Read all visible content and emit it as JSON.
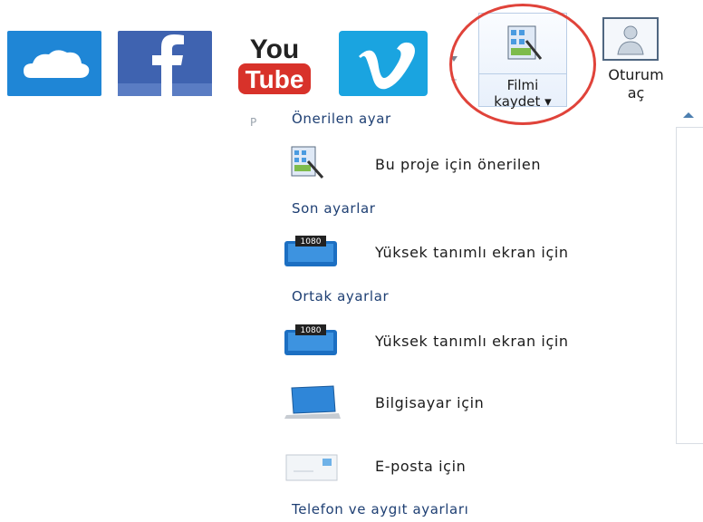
{
  "ribbon": {
    "youtube_top": "You",
    "youtube_bottom": "Tube",
    "save_movie": {
      "line1": "Filmi",
      "line2": "kaydet ▾"
    },
    "sign_in": {
      "line1": "Oturum",
      "line2": "aç"
    }
  },
  "menu": {
    "p_marker": "P",
    "sections": {
      "recommended": "Önerilen ayar",
      "recent": "Son ayarlar",
      "common": "Ortak ayarlar",
      "phone": "Telefon ve aygıt ayarları"
    },
    "items": [
      {
        "label": "Bu proje için önerilen",
        "icon": "film-save-icon"
      },
      {
        "label": "Yüksek tanımlı ekran için",
        "icon": "hd-1080-icon"
      },
      {
        "label": "Yüksek tanımlı ekran için",
        "icon": "hd-1080-icon"
      },
      {
        "label": "Bilgisayar için",
        "icon": "computer-icon"
      },
      {
        "label": "E-posta için",
        "icon": "email-icon"
      }
    ],
    "hd_badge": "1080"
  },
  "colors": {
    "onedrive": "#1f86d6",
    "facebook": "#3f63b0",
    "youtube_red": "#d8322a",
    "vimeo": "#1aa4e0",
    "highlight_circle": "#e0433a",
    "section_text": "#1e3f73"
  }
}
